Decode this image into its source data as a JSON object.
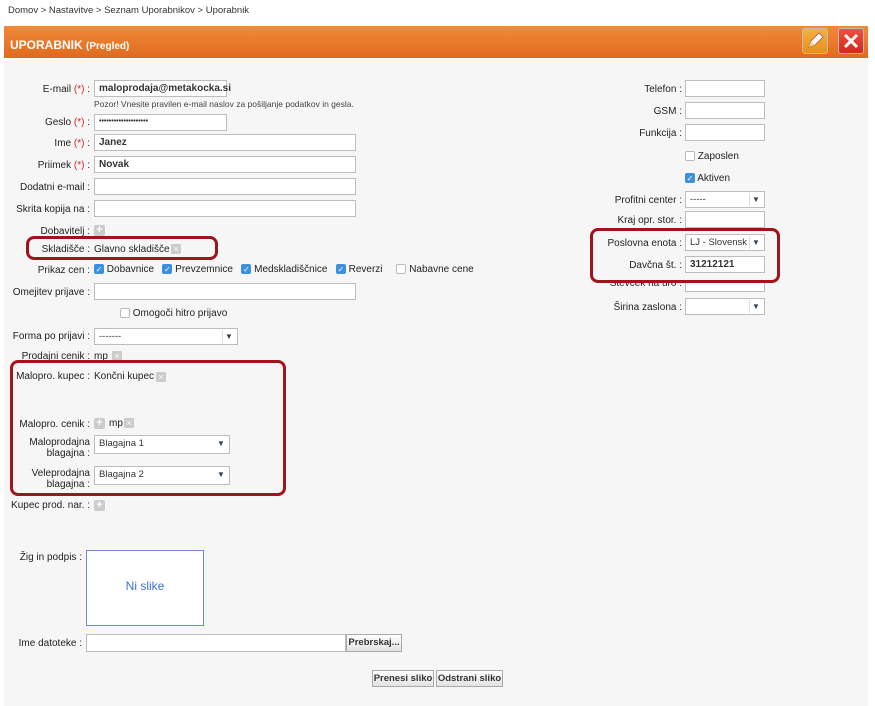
{
  "breadcrumb": "Domov  >  Nastavitve  >  Seznam Uporabnikov  >  Uporabnik",
  "header": {
    "title": "UPORABNIK",
    "subtitle": "(Pregled)"
  },
  "left": {
    "email_label": "E-mail",
    "email_value": "maloprodaja@metakocka.si",
    "email_hint": "Pozor! Vnesite pravilen e-mail naslov za pošiljanje podatkov in gesla.",
    "geslo_label": "Geslo",
    "geslo_value": "••••••••••••••••••••",
    "ime_label": "Ime",
    "ime_value": "Janez",
    "priimek_label": "Priimek",
    "priimek_value": "Novak",
    "dodatni_label": "Dodatni e-mail :",
    "skrita_label": "Skrita kopija na :",
    "dobavitelj_label": "Dobavitelj :",
    "skladisce_label": "Skladišče :",
    "skladisce_value": "Glavno skladišče",
    "prikaz_label": "Prikaz cen :",
    "prikaz_opts": [
      "Dobavnice",
      "Prevzemnice",
      "Medskladiščnice",
      "Reverzi",
      "Nabavne cene"
    ],
    "omejitev_label": "Omejitev prijave :",
    "omogoci_label": "Omogoči hitro prijavo",
    "forma_label": "Forma po prijavi :",
    "forma_value": "-------",
    "prodajni_label": "Prodajni cenik :",
    "prodajni_value": "mp",
    "malopro_kupec_label": "Malopro. kupec :",
    "malopro_kupec_value": "Končni kupec",
    "malopro_cenik_label": "Malopro. cenik :",
    "malopro_cenik_value": "mp",
    "malo_blag_label1": "Maloprodajna",
    "malo_blag_label2": "blagajna :",
    "malo_blag_value": "Blagajna 1",
    "velo_blag_label1": "Veleprodajna",
    "velo_blag_label2": "blagajna :",
    "velo_blag_value": "Blagajna 2",
    "kupec_label": "Kupec prod. nar. :",
    "zig_label": "Žig in podpis :",
    "ni_slike": "Ni slike",
    "ime_dat_label": "Ime datoteke :",
    "prebrskaj": "Prebrskaj...",
    "prenesi": "Prenesi sliko",
    "odstrani": "Odstrani sliko"
  },
  "right": {
    "telefon_label": "Telefon :",
    "gsm_label": "GSM :",
    "funkcija_label": "Funkcija :",
    "zaposlen_label": "Zaposlen",
    "aktiven_label": "Aktiven",
    "profitni_label": "Profitni center :",
    "profitni_value": "-----",
    "kraj_label": "Kraj opr. stor. :",
    "poslovna_label": "Poslovna enota :",
    "poslovna_value": "LJ - Slovensk",
    "davcna_label": "Davčna št. :",
    "davcna_value": "31212121",
    "stevecek_label": "Števček na uro :",
    "sirina_label": "Širina zaslona :"
  },
  "required_mark": "(*)",
  "colors": {
    "accent": "#e8761f",
    "highlight": "#a0151b",
    "checkbox": "#3d8fe0"
  }
}
